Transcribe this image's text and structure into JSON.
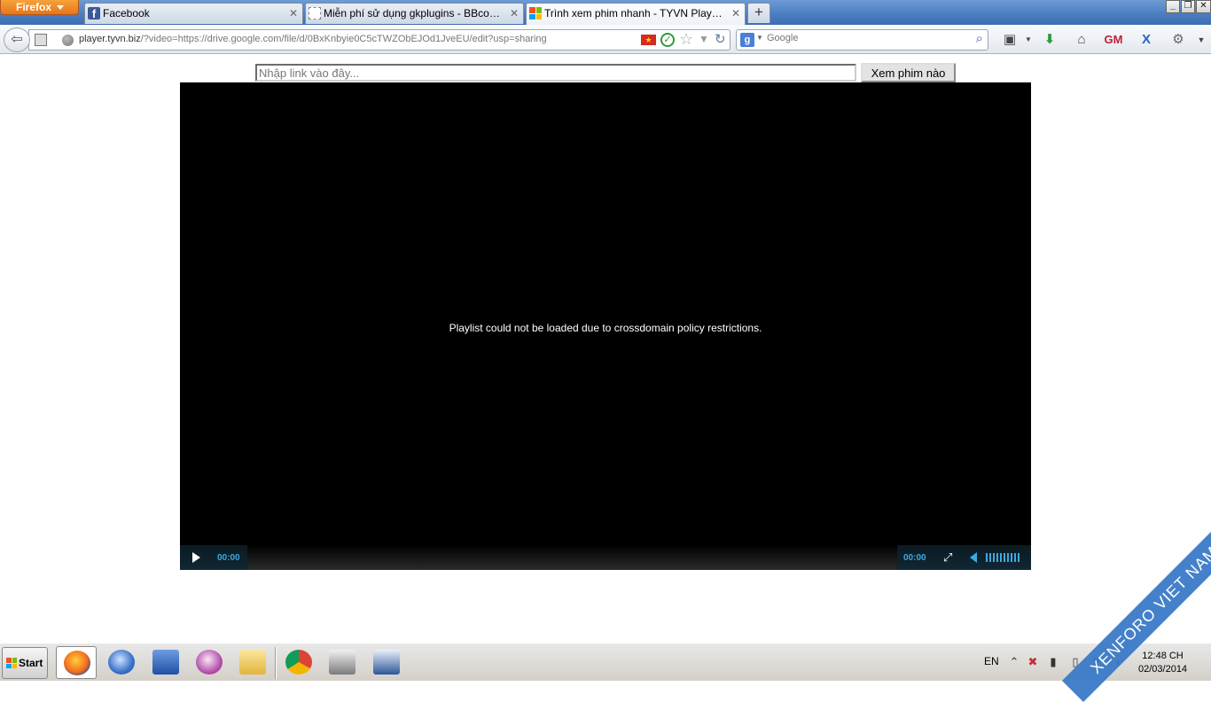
{
  "browser": {
    "menu_button": "Firefox",
    "tabs": [
      {
        "label": "Facebook"
      },
      {
        "label": "Miễn phí sử dụng gkplugins - BBcode play..."
      },
      {
        "label": "Trình xem phim nhanh - TYVN Player !"
      }
    ],
    "url": {
      "host": "player.tyvn.biz",
      "rest": "/?video=https://drive.google.com/file/d/0BxKnbyie0C5cTWZObEJOd1JveEU/edit?usp=sharing"
    },
    "search": {
      "placeholder": "Google"
    }
  },
  "page": {
    "link_input_placeholder": "Nhập link vào đây...",
    "watch_button": "Xem phim nào",
    "player": {
      "message": "Playlist could not be loaded due to crossdomain policy restrictions.",
      "elapsed": "00:00",
      "duration": "00:00",
      "volume_level": 1.0
    }
  },
  "taskbar": {
    "start_label": "Start",
    "language": "EN",
    "clock_time": "12:48 CH",
    "clock_date": "02/03/2014"
  },
  "watermark": {
    "text": "XENFORO VIET NAM"
  },
  "icons": {
    "tab_favicons": [
      "facebook-icon",
      "blank-page-icon",
      "windows-logo-icon"
    ],
    "toolbar": [
      "bookmarks-icon",
      "download-icon",
      "home-icon",
      "gm-icon",
      "x-icon",
      "addon-icon"
    ]
  },
  "colors": {
    "player_accent": "#3fa9df",
    "titlebar": "#4a7cc0",
    "firefox_button": "#e5761b"
  }
}
